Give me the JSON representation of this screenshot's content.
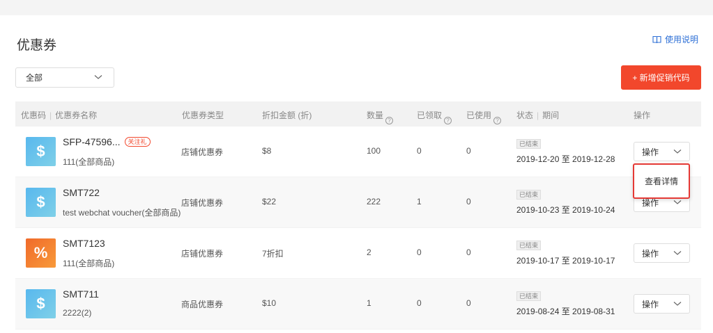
{
  "header": {
    "title": "优惠券",
    "guide_label": "使用说明"
  },
  "filter": {
    "selected": "全部"
  },
  "add_button_label": "+ 新增促销代码",
  "table": {
    "columns": {
      "code": "优惠码",
      "name": "优惠券名称",
      "type": "优惠券类型",
      "amount": "折扣金额 (折)",
      "quantity": "数量",
      "received": "已领取",
      "used": "已使用",
      "status": "状态",
      "period": "期间",
      "action": "操作"
    },
    "rows": [
      {
        "icon": "dollar-icon",
        "code": "SFP-47596...",
        "tag": "关注礼",
        "name": "111(全部商品)",
        "type": "店铺优惠券",
        "amount": "$8",
        "quantity": "100",
        "received": "0",
        "used": "0",
        "status": "已结束",
        "period": "2019-12-20 至 2019-12-28",
        "action": "操作"
      },
      {
        "icon": "dollar-icon",
        "code": "SMT722",
        "tag": "",
        "name": "test webchat voucher(全部商品)",
        "type": "店铺优惠券",
        "amount": "$22",
        "quantity": "222",
        "received": "1",
        "used": "0",
        "status": "已结束",
        "period": "2019-10-23 至 2019-10-24",
        "action": "操作"
      },
      {
        "icon": "percent-icon",
        "code": "SMT7123",
        "tag": "",
        "name": "111(全部商品)",
        "type": "店铺优惠券",
        "amount": "7折扣",
        "quantity": "2",
        "received": "0",
        "used": "0",
        "status": "已结束",
        "period": "2019-10-17 至 2019-10-17",
        "action": "操作"
      },
      {
        "icon": "dollar-icon",
        "code": "SMT711",
        "tag": "",
        "name": "2222(2)",
        "type": "商品优惠券",
        "amount": "$10",
        "quantity": "1",
        "received": "0",
        "used": "0",
        "status": "已结束",
        "period": "2019-08-24 至 2019-08-31",
        "action": "操作"
      }
    ]
  },
  "dropdown": {
    "item": "查看详情"
  },
  "colors": {
    "accent": "#f2472c",
    "link": "#2d6fd6",
    "highlight_border": "#e53935"
  }
}
